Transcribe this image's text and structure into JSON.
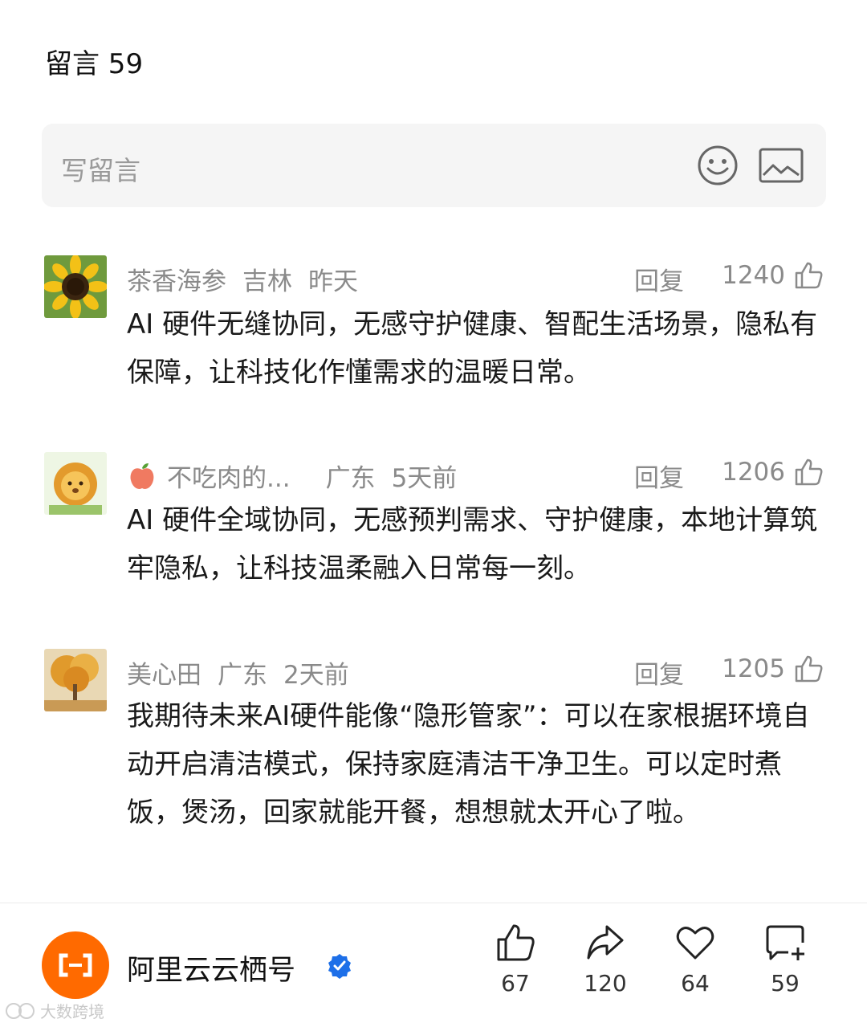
{
  "header": {
    "title": "留言 59"
  },
  "input": {
    "placeholder": "写留言"
  },
  "comments": [
    {
      "user": "茶香海参",
      "location": "吉林",
      "time": "昨天",
      "reply_label": "回复",
      "likes": "1240",
      "text": "AI 硬件无缝协同，无感守护健康、智配生活场景，隐私有保障，让科技化作懂需求的温暖日常。"
    },
    {
      "user": "不吃肉的...",
      "location": "广东",
      "time": "5天前",
      "reply_label": "回复",
      "likes": "1206",
      "text": "AI 硬件全域协同，无感预判需求、守护健康，本地计算筑牢隐私，让科技温柔融入日常每一刻。"
    },
    {
      "user": "美心田",
      "location": "广东",
      "time": "2天前",
      "reply_label": "回复",
      "likes": "1205",
      "text": "我期待未来AI硬件能像“隐形管家”：可以在家根据环境自动开启清洁模式，保持家庭清洁干净卫生。可以定时煮饭，煲汤，回家就能开餐，想想就太开心了啦。"
    }
  ],
  "footer": {
    "account_name": "阿里云云栖号",
    "actions": {
      "like_count": "67",
      "share_count": "120",
      "heart_count": "64",
      "comment_count": "59"
    }
  },
  "watermark": {
    "text": "大数跨境"
  },
  "colors": {
    "brand_orange": "#ff6a00",
    "verified_blue": "#1d6fe8",
    "muted_text": "#8a8a8a",
    "input_bg": "#f5f5f5"
  }
}
